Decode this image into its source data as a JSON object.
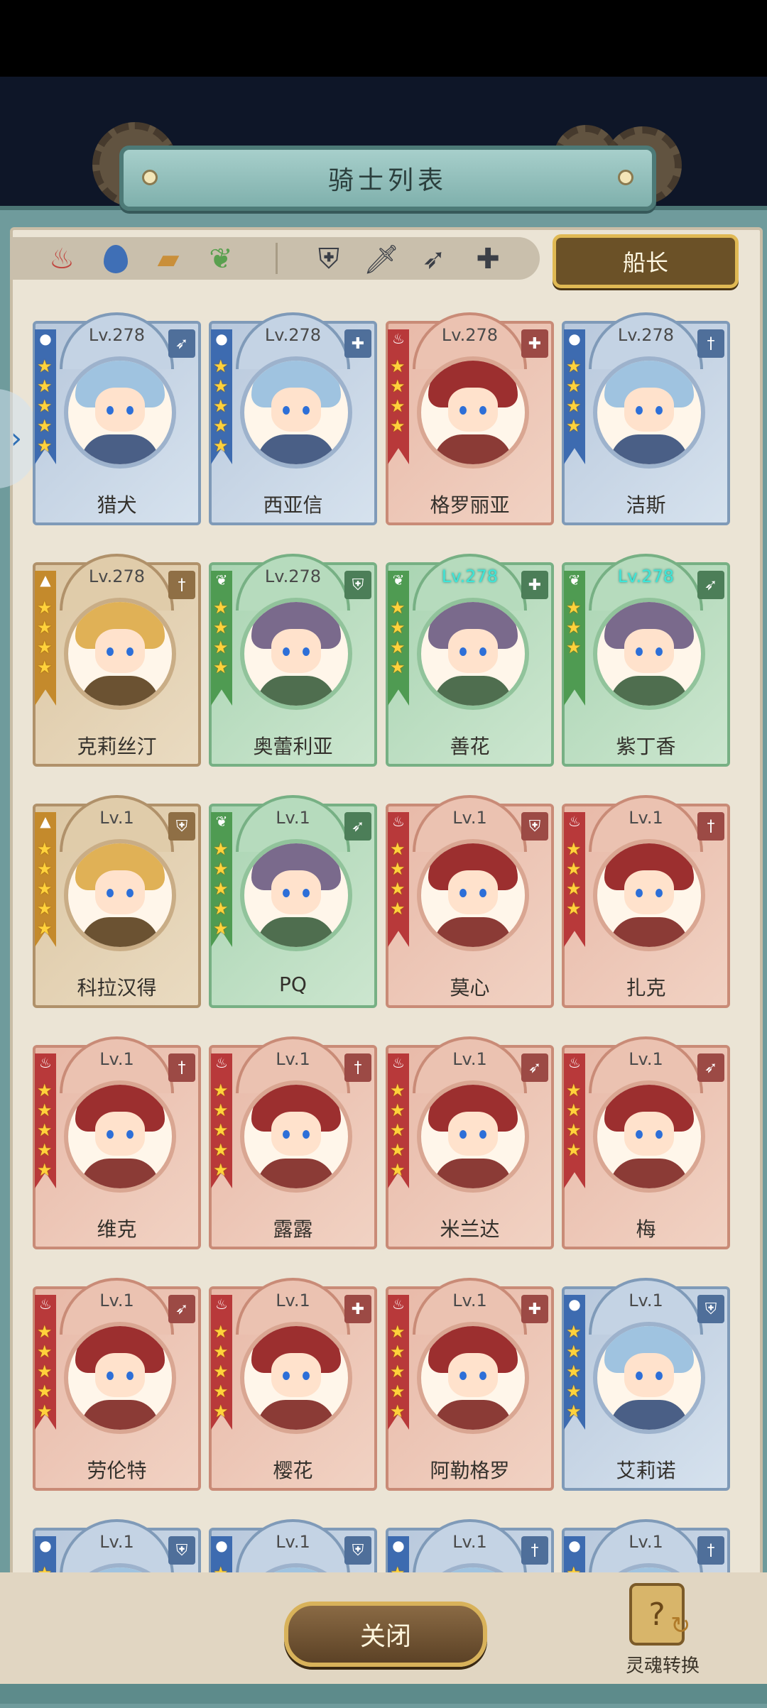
{
  "header": {
    "title": "骑士列表"
  },
  "filters": {
    "elements": [
      {
        "id": "fire",
        "icon": "flame-icon",
        "color": "#c0453e"
      },
      {
        "id": "water",
        "icon": "droplet-icon",
        "color": "#3f6fb6"
      },
      {
        "id": "earth",
        "icon": "castle-icon",
        "color": "#c98f3a"
      },
      {
        "id": "wind",
        "icon": "leaf-icon",
        "color": "#5aa04f"
      }
    ],
    "roles": [
      {
        "id": "shield",
        "icon": "shield-icon"
      },
      {
        "id": "sword",
        "icon": "sword-icon"
      },
      {
        "id": "bow",
        "icon": "bow-icon"
      },
      {
        "id": "heal",
        "icon": "cross-icon"
      }
    ],
    "captain_label": "船长"
  },
  "knights": [
    {
      "name": "猎犬",
      "level": "Lv.278",
      "element": "water",
      "role": "bow",
      "stars": 5
    },
    {
      "name": "西亚信",
      "level": "Lv.278",
      "element": "water",
      "role": "heal",
      "stars": 5
    },
    {
      "name": "格罗丽亚",
      "level": "Lv.278",
      "element": "fire",
      "role": "heal",
      "stars": 4
    },
    {
      "name": "洁斯",
      "level": "Lv.278",
      "element": "water",
      "role": "sword",
      "stars": 4
    },
    {
      "name": "克莉丝汀",
      "level": "Lv.278",
      "element": "earth",
      "role": "sword",
      "stars": 4
    },
    {
      "name": "奥蕾利亚",
      "level": "Lv.278",
      "element": "wind",
      "role": "shield",
      "stars": 4
    },
    {
      "name": "善花",
      "level": "Lv.278",
      "element": "wind",
      "role": "heal",
      "stars": 4,
      "level_highlight": true
    },
    {
      "name": "紫丁香",
      "level": "Lv.278",
      "element": "wind",
      "role": "bow",
      "stars": 3,
      "level_highlight": true
    },
    {
      "name": "科拉汉得",
      "level": "Lv.1",
      "element": "earth",
      "role": "shield",
      "stars": 5
    },
    {
      "name": "PQ",
      "level": "Lv.1",
      "element": "wind",
      "role": "bow",
      "stars": 5
    },
    {
      "name": "莫心",
      "level": "Lv.1",
      "element": "fire",
      "role": "shield",
      "stars": 4
    },
    {
      "name": "扎克",
      "level": "Lv.1",
      "element": "fire",
      "role": "sword",
      "stars": 4
    },
    {
      "name": "维克",
      "level": "Lv.1",
      "element": "fire",
      "role": "sword",
      "stars": 5
    },
    {
      "name": "露露",
      "level": "Lv.1",
      "element": "fire",
      "role": "sword",
      "stars": 5
    },
    {
      "name": "米兰达",
      "level": "Lv.1",
      "element": "fire",
      "role": "bow",
      "stars": 5
    },
    {
      "name": "梅",
      "level": "Lv.1",
      "element": "fire",
      "role": "bow",
      "stars": 4
    },
    {
      "name": "劳伦特",
      "level": "Lv.1",
      "element": "fire",
      "role": "bow",
      "stars": 5
    },
    {
      "name": "樱花",
      "level": "Lv.1",
      "element": "fire",
      "role": "heal",
      "stars": 5
    },
    {
      "name": "阿勒格罗",
      "level": "Lv.1",
      "element": "fire",
      "role": "heal",
      "stars": 5
    },
    {
      "name": "艾莉诺",
      "level": "Lv.1",
      "element": "water",
      "role": "shield",
      "stars": 5
    },
    {
      "name": "",
      "level": "Lv.1",
      "element": "water",
      "role": "shield",
      "stars": 5
    },
    {
      "name": "",
      "level": "Lv.1",
      "element": "water",
      "role": "shield",
      "stars": 5
    },
    {
      "name": "",
      "level": "Lv.1",
      "element": "water",
      "role": "sword",
      "stars": 5
    },
    {
      "name": "",
      "level": "Lv.1",
      "element": "water",
      "role": "sword",
      "stars": 5
    }
  ],
  "footer": {
    "close_label": "关闭",
    "soul_label": "灵魂转换"
  }
}
